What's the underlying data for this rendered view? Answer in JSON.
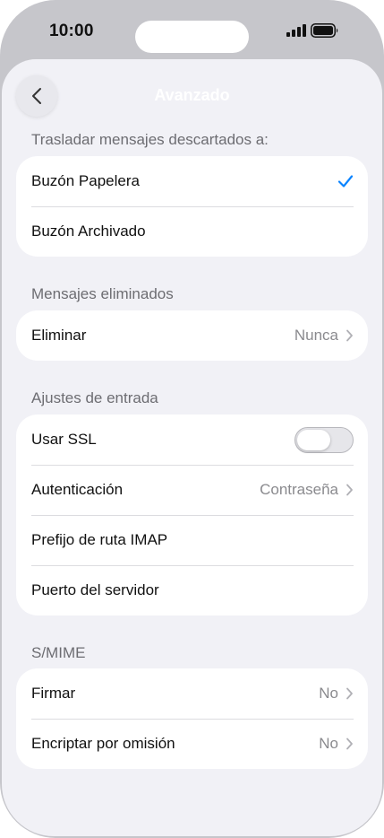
{
  "status_bar": {
    "time": "10:00"
  },
  "nav": {
    "title": "Avanzado",
    "back_icon": "chevron-left-icon"
  },
  "colors": {
    "accent": "#0a84ff",
    "background": "#f1f1f6",
    "secondary_text": "#8a8a8e"
  },
  "sections": {
    "discarded": {
      "header": "Trasladar mensajes descartados a:",
      "rows": [
        {
          "label": "Buzón Papelera",
          "selected": true,
          "icon": "checkmark-icon"
        },
        {
          "label": "Buzón Archivado",
          "selected": false
        }
      ]
    },
    "deleted": {
      "header": "Mensajes eliminados",
      "rows": [
        {
          "label": "Eliminar",
          "value": "Nunca",
          "icon": "chevron-right-icon"
        }
      ]
    },
    "incoming": {
      "header": "Ajustes de entrada",
      "rows": [
        {
          "label": "Usar SSL",
          "toggle_on": false
        },
        {
          "label": "Autenticación",
          "value": "Contraseña",
          "icon": "chevron-right-icon"
        },
        {
          "label": "Prefijo de ruta IMAP"
        },
        {
          "label": "Puerto del servidor"
        }
      ]
    },
    "smime": {
      "header": "S/MIME",
      "rows": [
        {
          "label": "Firmar",
          "value": "No",
          "icon": "chevron-right-icon"
        },
        {
          "label": "Encriptar por omisión",
          "value": "No",
          "icon": "chevron-right-icon"
        }
      ]
    }
  }
}
